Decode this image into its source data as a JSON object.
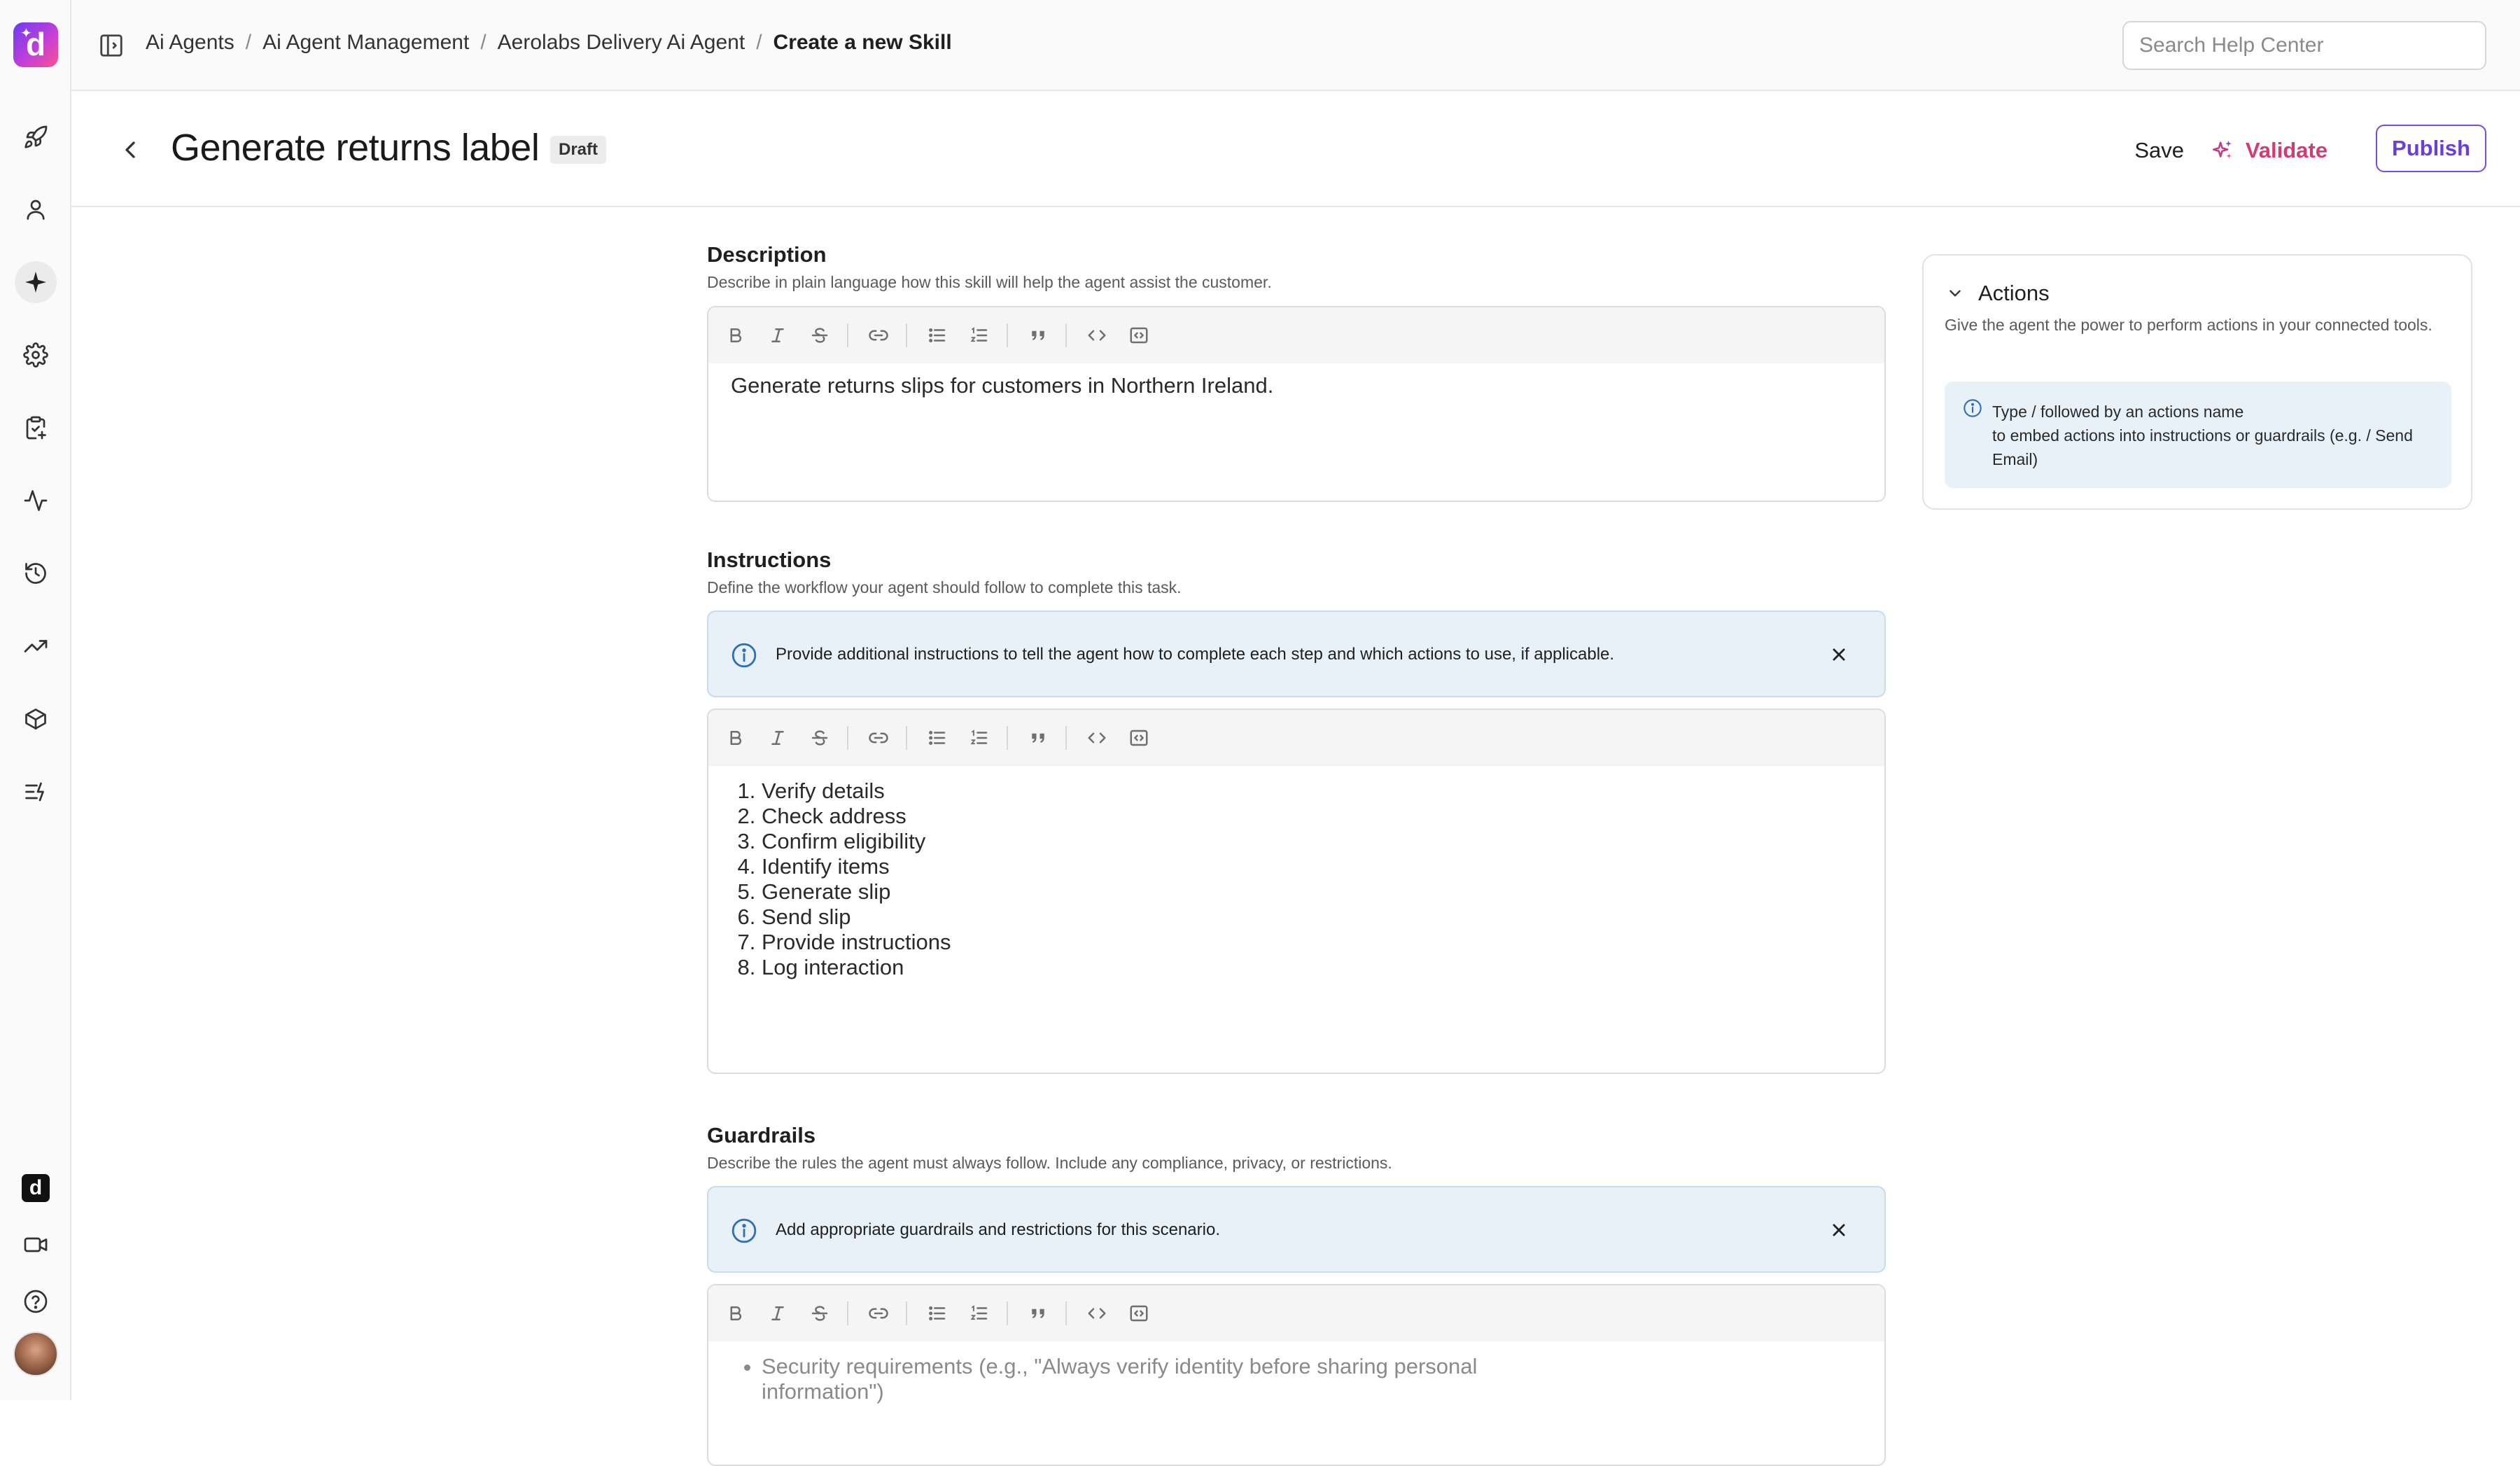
{
  "sidebar": {
    "logo_letter": "d",
    "items": [
      {
        "icon": "rocket-icon",
        "label": "Launch"
      },
      {
        "icon": "user-icon",
        "label": "Customers"
      },
      {
        "icon": "sparkle-icon",
        "label": "AI Agents"
      },
      {
        "icon": "gear-icon",
        "label": "Settings"
      },
      {
        "icon": "clipboard-check-icon",
        "label": "Tasks"
      },
      {
        "icon": "activity-icon",
        "label": "Activity"
      },
      {
        "icon": "history-icon",
        "label": "History"
      },
      {
        "icon": "trending-up-icon",
        "label": "Analytics"
      },
      {
        "icon": "cube-icon",
        "label": "Products"
      },
      {
        "icon": "flows-icon",
        "label": "Flows"
      }
    ],
    "bottom": {
      "mini_logo_letter": "d"
    }
  },
  "topbar": {
    "breadcrumb": [
      "Ai Agents",
      "Ai Agent Management",
      "Aerolabs Delivery Ai Agent"
    ],
    "current": "Create a new Skill",
    "search_placeholder": "Search Help Center"
  },
  "header": {
    "title": "Generate returns label",
    "badge": "Draft",
    "save_label": "Save",
    "validate_label": "Validate",
    "publish_label": "Publish"
  },
  "description": {
    "title": "Description",
    "subtitle": "Describe in plain language how this skill will help the agent assist the customer.",
    "content": "Generate returns slips for customers in Northern Ireland."
  },
  "instructions": {
    "title": "Instructions",
    "subtitle": "Define the workflow your agent should follow to complete this task.",
    "info": "Provide additional instructions to tell the agent how to complete each step and which actions to use, if applicable.",
    "steps": [
      "Verify details",
      "Check address",
      "Confirm eligibility",
      "Identify items",
      "Generate slip",
      "Send slip",
      "Provide instructions",
      "Log interaction"
    ]
  },
  "guardrails": {
    "title": "Guardrails",
    "subtitle": "Describe the rules the agent must always follow. Include any compliance, privacy, or restrictions.",
    "info": "Add appropriate guardrails and restrictions for this scenario.",
    "placeholder_line1": "Security requirements (e.g., \"Always verify identity before sharing personal",
    "placeholder_line2": "information\")"
  },
  "actions_panel": {
    "title": "Actions",
    "description": "Give the agent the power to perform actions in your connected tools.",
    "tip_line1": "Type / followed by an actions name",
    "tip_line2": "to embed actions into instructions or guardrails (e.g. / Send Email)"
  },
  "colors": {
    "accent_purple": "#6a3fd8",
    "validate_pink": "#d63a72",
    "info_bg": "#e9f1f8",
    "info_icon": "#2f6fb6"
  }
}
